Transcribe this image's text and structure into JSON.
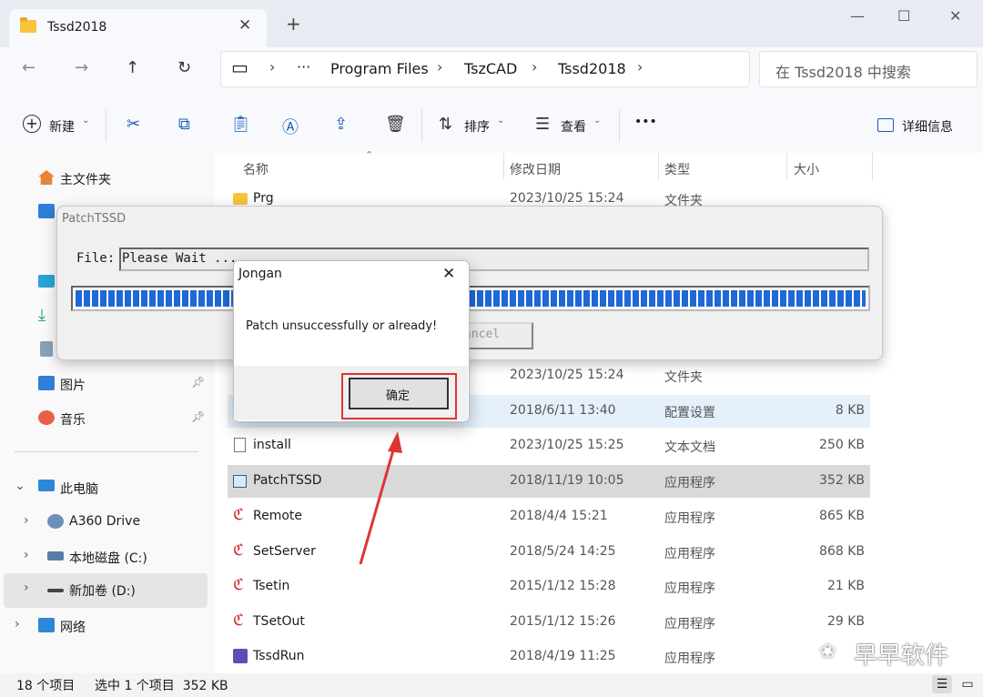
{
  "window": {
    "tab_title": "Tssd2018",
    "new_tab": "+",
    "min": "—",
    "max": "☐",
    "close": "✕"
  },
  "nav": {
    "back": "←",
    "forward": "→",
    "up": "↑",
    "refresh": "↻",
    "pc_icon": "▭",
    "breadcrumbs": [
      "Program Files",
      "TszCAD",
      "Tssd2018"
    ],
    "ellipsis": "···",
    "search_placeholder": "在 Tssd2018 中搜索"
  },
  "toolbar": {
    "new_label": "新建",
    "sort_label": "排序",
    "view_label": "查看",
    "more": "•••",
    "details_label": "详细信息"
  },
  "sidebar": {
    "items": [
      {
        "label": "主文件夹"
      },
      {
        "label": "图片"
      },
      {
        "label": "音乐"
      },
      {
        "label": "此电脑"
      },
      {
        "label": "A360 Drive"
      },
      {
        "label": "本地磁盘 (C:)"
      },
      {
        "label": "新加卷 (D:)"
      },
      {
        "label": "网络"
      }
    ]
  },
  "columns": {
    "name": "名称",
    "date": "修改日期",
    "type": "类型",
    "size": "大小"
  },
  "files": [
    {
      "name": "Prg",
      "date": "2023/10/25 15:24",
      "type": "文件夹",
      "size": ""
    },
    {
      "name": "",
      "date": "2023/10/25 15:24",
      "type": "文件夹",
      "size": ""
    },
    {
      "name": "",
      "date": "2018/6/11 13:40",
      "type": "配置设置",
      "size": "8 KB"
    },
    {
      "name": "install",
      "date": "2023/10/25 15:25",
      "type": "文本文档",
      "size": "250 KB"
    },
    {
      "name": "PatchTSSD",
      "date": "2018/11/19 10:05",
      "type": "应用程序",
      "size": "352 KB"
    },
    {
      "name": "Remote",
      "date": "2018/4/4 15:21",
      "type": "应用程序",
      "size": "865 KB"
    },
    {
      "name": "SetServer",
      "date": "2018/5/24 14:25",
      "type": "应用程序",
      "size": "868 KB"
    },
    {
      "name": "Tsetin",
      "date": "2015/1/12 15:28",
      "type": "应用程序",
      "size": "21 KB"
    },
    {
      "name": "TSetOut",
      "date": "2015/1/12 15:26",
      "type": "应用程序",
      "size": "29 KB"
    },
    {
      "name": "TssdRun",
      "date": "2018/4/19 11:25",
      "type": "应用程序",
      "size": ""
    }
  ],
  "status": {
    "count": "18 个项目",
    "selected": "选中 1 个项目  352 KB"
  },
  "patch": {
    "title": "PatchTSSD",
    "file_label": "File:",
    "file_value": "Please Wait ...",
    "progress": 1.0,
    "cancel_label": "ancel"
  },
  "dialog": {
    "title": "Jongan",
    "message": "Patch unsuccessfully or already!",
    "ok_label": "确定",
    "close": "✕"
  },
  "watermark": {
    "text": "早早软件",
    "icon": "❀"
  },
  "colors": {
    "accent": "#1f68d6",
    "highlight_red": "#e03434",
    "folder": "#f7c33d"
  }
}
